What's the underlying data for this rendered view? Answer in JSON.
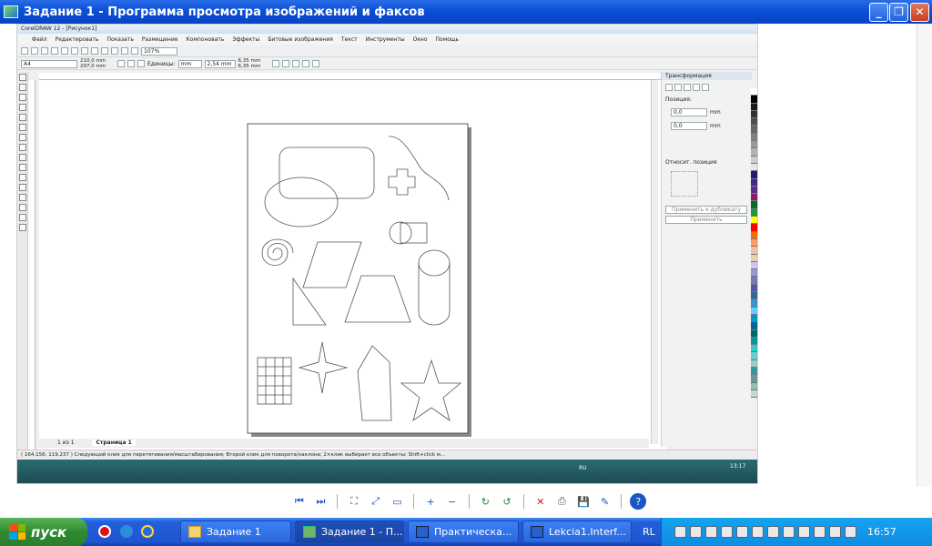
{
  "window": {
    "title": "Задание 1 - Программа просмотра изображений и факсов"
  },
  "corel": {
    "title": "CorelDRAW 12 - [Рисунок1]",
    "menu": [
      "Файл",
      "Редактировать",
      "Показать",
      "Размещение",
      "Компоновать",
      "Эффекты",
      "Битовые изображения",
      "Текст",
      "Инструменты",
      "Окно",
      "Помощь"
    ],
    "zoom": "107%",
    "paper": "A4",
    "width": "210,0 mm",
    "height": "297,0 mm",
    "units_label": "Единицы:",
    "units": "mm",
    "nudge": "2,54 mm",
    "dup1": "6,35 mm",
    "dup2": "6,35 mm",
    "panel": {
      "title": "Трансформация",
      "position_label": "Позиция:",
      "x": "0,0",
      "y": "0,0",
      "unit": "mm",
      "relative": "Относит. позиция",
      "apply_dup": "Применить к дубликату",
      "apply": "Применить"
    },
    "pages": {
      "count": "1 из 1",
      "tab": "Страница 1"
    },
    "status": "( 164,156; 119,237 )     Следующий клик для перетягивания/масштабирования; Второй клик для поворота/наклона; 2×клик выбирает все объекты; Shift+click м...",
    "inner_clock": "13:17",
    "inner_lang": "RU",
    "palette": [
      "#ffffff",
      "#000000",
      "#1a1a1a",
      "#333",
      "#4d4d4d",
      "#666",
      "#808080",
      "#999",
      "#b3b3b3",
      "#ccc",
      "#e6e6e6",
      "#1e1e7a",
      "#3b2a8c",
      "#5a2c8f",
      "#8b1e6b",
      "#0a6a2e",
      "#1a9a3a",
      "#ffff00",
      "#ff0000",
      "#ff6a00",
      "#ff9966",
      "#f0c0a0",
      "#e8d0b0",
      "#c6c6ff",
      "#9999cc",
      "#7777bb",
      "#5555aa",
      "#336699",
      "#3399cc",
      "#66ccff",
      "#0099cc",
      "#006699",
      "#006666",
      "#009999",
      "#33cccc",
      "#66cccc",
      "#99cccc",
      "#339999",
      "#669999",
      "#99bbaa",
      "#bbddcc"
    ]
  },
  "controls": {
    "prev": "⏮",
    "next": "⏭",
    "best_fit": "⛶",
    "actual": "⤢",
    "slideshow": "▭",
    "zoom_in": "+",
    "zoom_out": "−",
    "rotate_cw": "↻",
    "rotate_ccw": "↺",
    "delete": "✕",
    "print": "⎙",
    "save": "💾",
    "edit": "✎",
    "help": "?"
  },
  "taskbar": {
    "start": "пуск",
    "tasks": [
      "Задание 1",
      "Задание 1 - П...",
      "Практическа...",
      "Lekcia1.Interf..."
    ],
    "lang": "RL",
    "clock": "16:57"
  }
}
